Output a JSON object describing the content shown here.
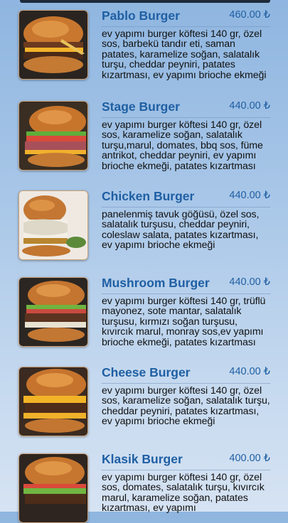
{
  "menu": {
    "items": [
      {
        "name": "Pablo Burger",
        "price": "460.00 ₺",
        "description": "ev yapımı burger köftesi 140 gr, özel sos, barbekü tandır eti, saman patates, karamelize soğan, salatalık turşu, cheddar peyniri, patates kızartması, ev yapımı brioche ekmeği"
      },
      {
        "name": "Stage Burger",
        "price": "440.00 ₺",
        "description": "ev yapımı burger köftesi 140 gr, özel sos, karamelize soğan, salatalık turşu,marul, domates, bbq sos, füme antrikot, cheddar peyniri, ev yapımı brioche ekmeği, patates kızartması"
      },
      {
        "name": "Chicken Burger",
        "price": "440.00 ₺",
        "description": "panelenmiş tavuk göğüsü, özel sos, salatalık turşusu, cheddar peyniri, coleslaw salata, patates kızartması, ev yapımı brioche ekmeği"
      },
      {
        "name": "Mushroom Burger",
        "price": "440.00 ₺",
        "description": "ev yapımı burger köftesi 140 gr, trüflü mayonez, sote mantar, salatalık turşusu, kırmızı soğan turşusu, kıvırcık marul, monray sos,ev yapımı brioche ekmeği, patates kızartması"
      },
      {
        "name": "Cheese Burger",
        "price": "440.00 ₺",
        "description": "ev yapımı burger köftesi 140 gr, özel sos, karamelize soğan, salatalık turşu, cheddar peyniri, patates kızartması, ev yapımı brioche ekmeği"
      },
      {
        "name": "Klasik Burger",
        "price": "400.00 ₺",
        "description": "ev yapımı burger köftesi 140 gr, özel sos, domates, salatalık turşu, kıvırcık marul, karamelize soğan, patates kızartması, ev yapımı"
      }
    ]
  },
  "colors": {
    "accent": "#1f5fa3",
    "text": "#111111"
  }
}
